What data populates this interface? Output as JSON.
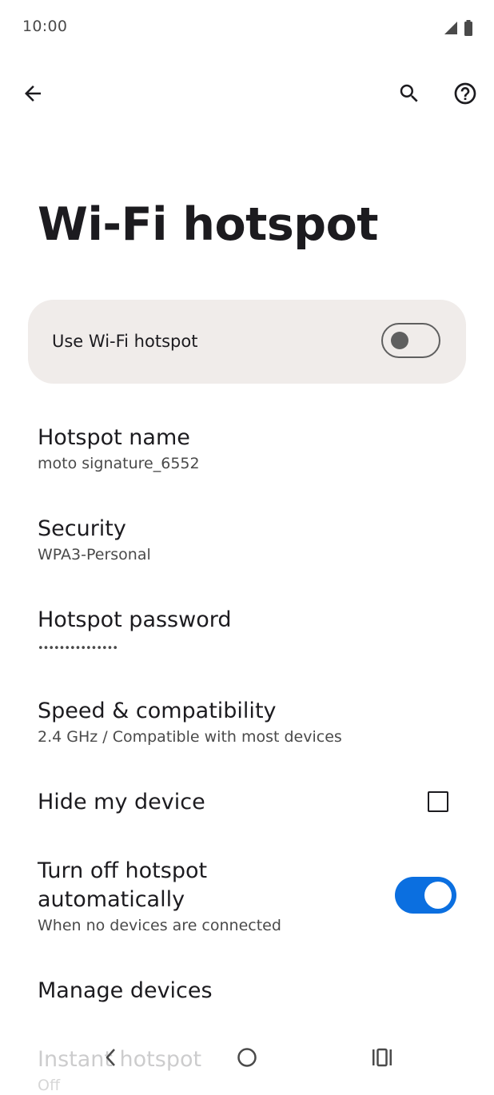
{
  "status_bar": {
    "time": "10:00"
  },
  "page": {
    "title": "Wi-Fi hotspot"
  },
  "main_switch": {
    "label": "Use Wi-Fi hotspot",
    "checked": false
  },
  "preferences": [
    {
      "title": "Hotspot name",
      "summary": "moto signature_6552"
    },
    {
      "title": "Security",
      "summary": "WPA3-Personal"
    },
    {
      "title": "Hotspot password",
      "summary": "•••••••••••••••"
    },
    {
      "title": "Speed & compatibility",
      "summary": "2.4 GHz / Compatible with most devices"
    },
    {
      "title": "Hide my device",
      "checked": false
    },
    {
      "title": "Turn off hotspot automatically",
      "summary": "When no devices are connected",
      "checked": true
    },
    {
      "title": "Manage devices"
    },
    {
      "title": "Instant hotspot",
      "summary": "Off"
    }
  ],
  "icons": {
    "back": "arrow-back-icon",
    "search": "search-icon",
    "help": "help-circle-icon",
    "signal": "signal-icon",
    "battery": "battery-icon",
    "nav_back": "nav-back-icon",
    "nav_home": "nav-home-icon",
    "nav_recents": "nav-recents-icon"
  },
  "colors": {
    "accent": "#0b6fe0",
    "card_bg": "#f0ecea"
  }
}
